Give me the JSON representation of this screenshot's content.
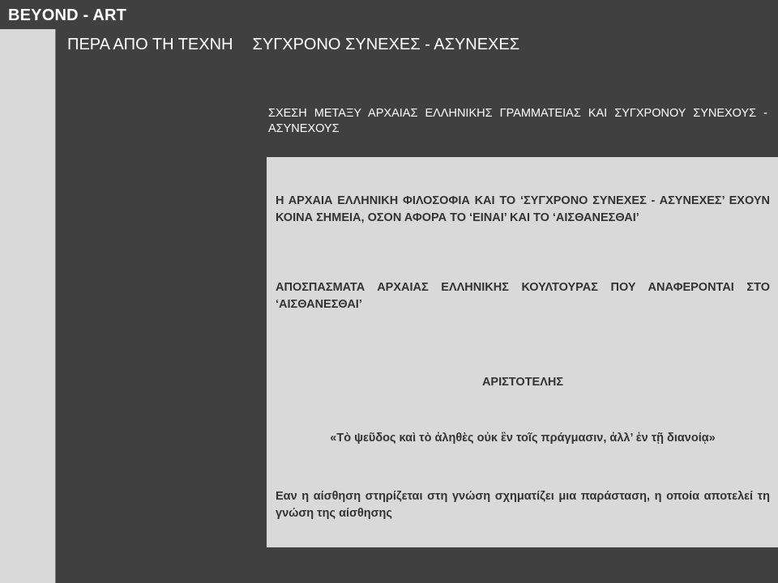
{
  "site": {
    "title": "BEYOND - ART"
  },
  "header": {
    "title_part1": "ΠΕΡΑ ΑΠΟ ΤΗ ΤΕΧΝΗ",
    "title_part2": "ΣΥΓΧΡΟΝΟ ΣΥΝΕΧΕΣ - ΑΣΥΝΕΧΕΣ"
  },
  "section": {
    "subtitle": "ΣΧΕΣΗ ΜΕΤΑΞΥ ΑΡΧΑΙΑΣ ΕΛΛΗΝΙΚΗΣ ΓΡΑΜΜΑΤΕΙΑΣ ΚΑΙ ΣΥΓΧΡΟΝΟΥ ΣΥΝΕΧΟΥΣ - ΑΣΥΝΕΧΟΥΣ"
  },
  "content": {
    "paragraph_1": "Η ΑΡΧΑΙΑ ΕΛΛΗΝΙΚΗ ΦΙΛΟΣΟΦΙΑ ΚΑΙ ΤΟ ‘ΣΥΓΧΡΟΝΟ ΣΥΝΕΧΕΣ - ΑΣΥΝΕΧΕΣ’ ΕΧΟΥΝ ΚΟΙΝΑ ΣΗΜΕΙΑ, ΟΣΟΝ ΑΦΟΡΑ ΤΟ ‘ΕΙΝΑΙ’ ΚΑΙ ΤΟ ‘ΑΙΣΘΑΝΕΣΘΑΙ’",
    "paragraph_2": "ΑΠΟΣΠΑΣΜΑΤΑ ΑΡΧΑΙΑΣ ΕΛΛΗΝΙΚΗΣ ΚΟΥΛΤΟΥΡΑΣ ΠΟΥ ΑΝΑΦΕΡΟΝΤΑΙ ΣΤΟ ‘ΑΙΣΘΑΝΕΣΘΑΙ’",
    "author": "ΑΡΙΣΤΟΤΕΛΗΣ",
    "quote": "«Τὸ ψεῦδος καὶ τὸ ἀληθὲς οὐκ ἒν τοῖς  πράγμασιν, ἀλλ’ ἐν τῇ διανοίᾳ»",
    "explanation": "Εαν η αίσθηση στηρίζεται στη γνώση σχηματίζει μια παράσταση, η οποία αποτελεί τη γνώση της αίσθησης"
  }
}
